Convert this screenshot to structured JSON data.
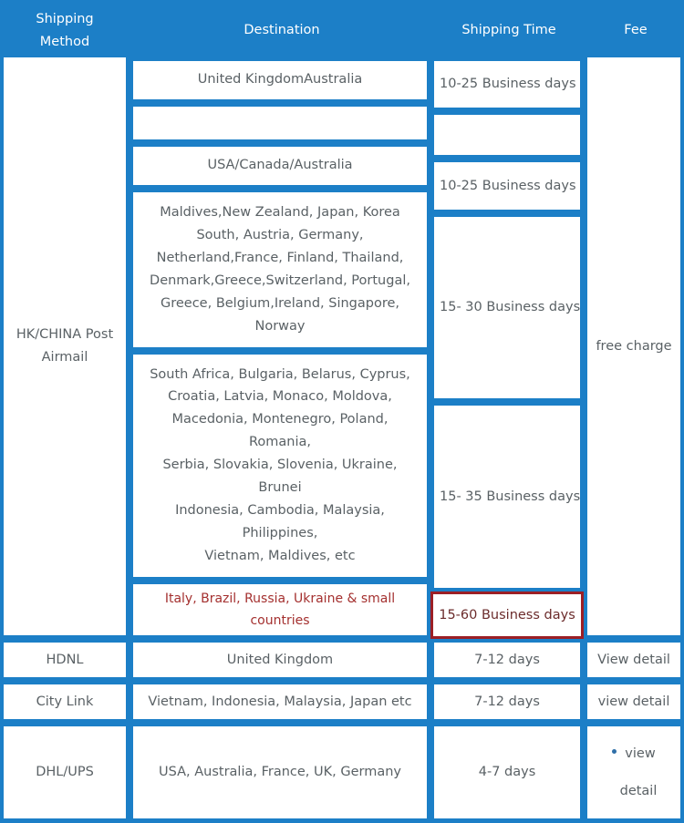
{
  "table": {
    "accent_color": "#1c7fc7",
    "text_color": "#5a6165",
    "highlight_color": "#9c1f25",
    "headers": {
      "method": "Shipping Method",
      "destination": "Destination",
      "time": "Shipping Time",
      "fee": "Fee"
    },
    "rows": [
      {
        "method": "HK/CHINA Post Airmail",
        "method_line1": "HK/CHINA Post",
        "method_line2": "Airmail",
        "fee": "free charge",
        "subrows": [
          {
            "destination": "United KingdomAustralia",
            "time": "10-25 Business days"
          },
          {
            "destination": "",
            "time": ""
          },
          {
            "destination": "USA/Canada/Australia",
            "time": "10-25 Business days"
          },
          {
            "destination_lines": [
              "Maldives,New Zealand, Japan, Korea",
              "South, Austria, Germany,",
              "Netherland,France, Finland, Thailand,",
              "Denmark,Greece,Switzerland, Portugal,",
              "Greece, Belgium,Ireland, Singapore,",
              "Norway"
            ],
            "time": "15- 30 Business days"
          },
          {
            "destination_lines": [
              "South Africa, Bulgaria, Belarus, Cyprus,",
              "Croatia, Latvia, Monaco, Moldova,",
              "Macedonia, Montenegro, Poland, Romania,",
              "Serbia, Slovakia, Slovenia, Ukraine, Brunei",
              "Indonesia, Cambodia, Malaysia, Philippines,",
              "Vietnam, Maldives, etc"
            ],
            "time": "15- 35 Business days"
          },
          {
            "destination": "Italy, Brazil, Russia, Ukraine & small countries",
            "time": "15-60 Business days",
            "highlighted": true
          }
        ]
      },
      {
        "method": "HDNL",
        "destination": "United Kingdom",
        "time": "7-12 days",
        "fee": "View detail"
      },
      {
        "method": "City Link",
        "destination": "Vietnam, Indonesia, Malaysia, Japan etc",
        "time": "7-12 days",
        "fee": "view detail"
      },
      {
        "method": "DHL/UPS",
        "destination": "USA, Australia, France, UK, Germany",
        "time": "4-7 days",
        "fee_bullet": "view",
        "fee_second_line": "detail"
      }
    ]
  }
}
